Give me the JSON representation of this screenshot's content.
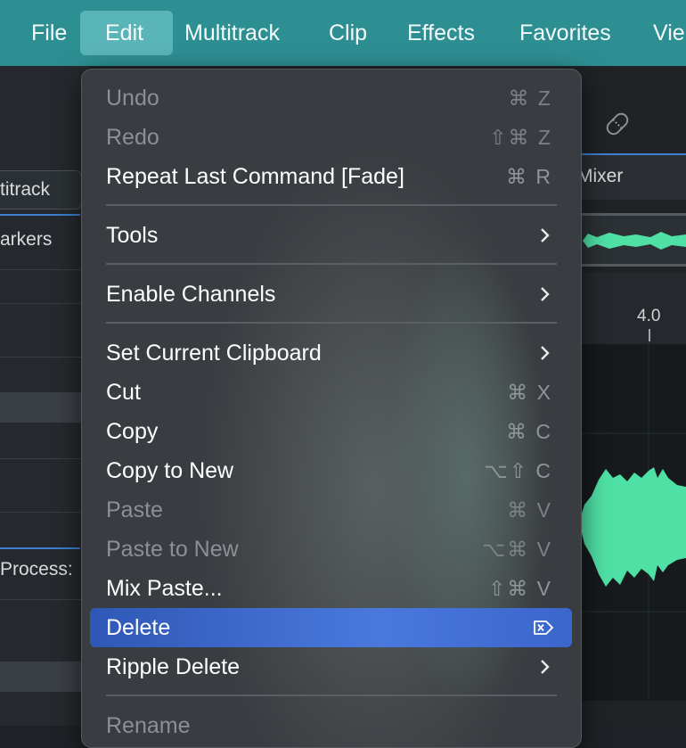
{
  "menubar": {
    "items": [
      "File",
      "Edit",
      "Multitrack",
      "Clip",
      "Effects",
      "Favorites",
      "Vie"
    ]
  },
  "background": {
    "left_texts": [
      "titrack",
      "arkers",
      "Process:"
    ],
    "right_texts": [
      "Mixer",
      "4.0"
    ]
  },
  "edit_menu": {
    "items": [
      {
        "label": "Undo",
        "shortcut": "⌘ Z",
        "enabled": false
      },
      {
        "label": "Redo",
        "shortcut": "⇧⌘ Z",
        "enabled": false
      },
      {
        "label": "Repeat Last Command [Fade]",
        "shortcut": "⌘ R",
        "enabled": true
      },
      {
        "label": "Tools",
        "submenu": true,
        "enabled": true
      },
      {
        "label": "Enable Channels",
        "submenu": true,
        "enabled": true
      },
      {
        "label": "Set Current Clipboard",
        "submenu": true,
        "enabled": true
      },
      {
        "label": "Cut",
        "shortcut": "⌘ X",
        "enabled": true
      },
      {
        "label": "Copy",
        "shortcut": "⌘ C",
        "enabled": true
      },
      {
        "label": "Copy to New",
        "shortcut": "⌥⇧ C",
        "enabled": true
      },
      {
        "label": "Paste",
        "shortcut": "⌘ V",
        "enabled": false
      },
      {
        "label": "Paste to New",
        "shortcut": "⌥⌘ V",
        "enabled": false
      },
      {
        "label": "Mix Paste...",
        "shortcut": "⇧⌘ V",
        "enabled": true
      },
      {
        "label": "Delete",
        "shortcut_icon": "delete-forward-icon",
        "enabled": true,
        "highlighted": true
      },
      {
        "label": "Ripple Delete",
        "submenu": true,
        "enabled": true
      },
      {
        "label": "Rename",
        "enabled": false
      }
    ]
  },
  "colors": {
    "menubar": "#2e8f93",
    "highlight": "#3b66cc",
    "waveform": "#4fe0a6"
  }
}
